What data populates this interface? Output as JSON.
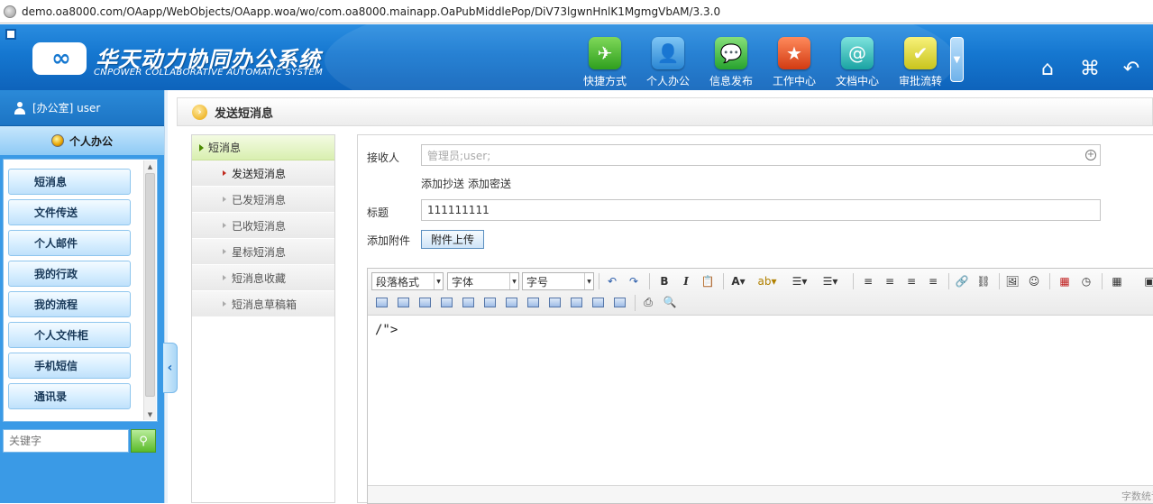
{
  "browser": {
    "url": "demo.oa8000.com/OAapp/WebObjects/OAapp.woa/wo/com.oa8000.mainapp.OaPubMiddlePop/DiV73lgwnHnlK1MgmgVbAM/3.3.0"
  },
  "header": {
    "title": "华天动力协同办公系统",
    "subtitle": "CNPOWER COLLABORATIVE AUTOMATIC SYSTEM",
    "nav": [
      {
        "label": "快捷方式",
        "icon": "paper-plane-icon"
      },
      {
        "label": "个人办公",
        "icon": "person-icon"
      },
      {
        "label": "信息发布",
        "icon": "chat-bubble-icon"
      },
      {
        "label": "工作中心",
        "icon": "star-icon"
      },
      {
        "label": "文档中心",
        "icon": "address-book-icon"
      },
      {
        "label": "审批流转",
        "icon": "checkmark-icon"
      }
    ],
    "right_icons": [
      "home-icon",
      "apps-icon",
      "back-icon"
    ]
  },
  "sidebar": {
    "user": "[办公室] user",
    "section": "个人办公",
    "items": [
      "短消息",
      "文件传送",
      "个人邮件",
      "我的行政",
      "我的流程",
      "个人文件柜",
      "手机短信",
      "通讯录"
    ],
    "search_placeholder": "关键字"
  },
  "page": {
    "title": "发送短消息",
    "subnav": {
      "head": "短消息",
      "items": [
        "发送短消息",
        "已发短消息",
        "已收短消息",
        "星标短消息",
        "短消息收藏",
        "短消息草稿箱"
      ]
    },
    "form": {
      "recipient_label": "接收人",
      "recipient_placeholder": "管理员;user;",
      "cc_link": "添加抄送",
      "bcc_link": "添加密送",
      "subject_label": "标题",
      "subject_value": "111111111",
      "attach_label": "添加附件",
      "attach_button": "附件上传"
    },
    "editor": {
      "paragraph_select": "段落格式",
      "font_select": "字体",
      "size_select": "字号",
      "content": "/\">",
      "word_count_label": "字数统计"
    }
  }
}
